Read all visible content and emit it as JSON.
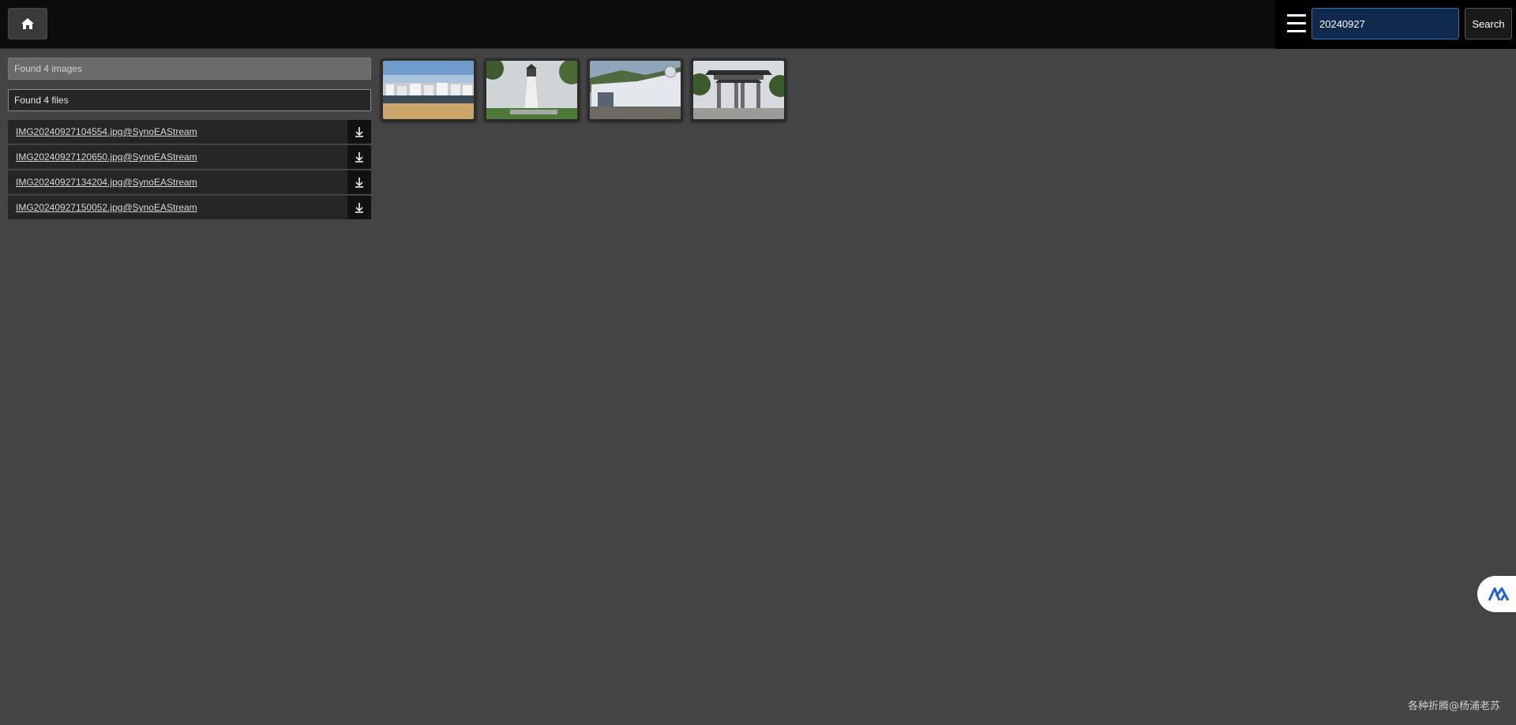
{
  "header": {
    "home_icon": "home-icon",
    "menu_icon": "hamburger-menu-icon",
    "search_value": "20240927",
    "search_button_label": "Search"
  },
  "results": {
    "images_count_label": "Found 4 images",
    "files_count_label": "Found 4 files",
    "files": [
      {
        "name": "IMG20240927104554.jpg@SynoEAStream"
      },
      {
        "name": "IMG20240927120650.jpg@SynoEAStream"
      },
      {
        "name": "IMG20240927134204.jpg@SynoEAStream"
      },
      {
        "name": "IMG20240927150052.jpg@SynoEAStream"
      }
    ],
    "download_icon": "download-arrow-icon"
  },
  "thumbnails": [
    {
      "subject": "coastal white buildings with beach"
    },
    {
      "subject": "white lighthouse with trees"
    },
    {
      "subject": "modern white museum building"
    },
    {
      "subject": "traditional chinese gateway archway"
    }
  ],
  "floating_logo_icon": "app-logo-icon",
  "watermark": "各种折腾@杨浦老苏",
  "colors": {
    "background": "#444444",
    "topbar": "#0c0c0c",
    "search_field": "#0f2a4d",
    "logo_blue": "#1f63d6"
  }
}
